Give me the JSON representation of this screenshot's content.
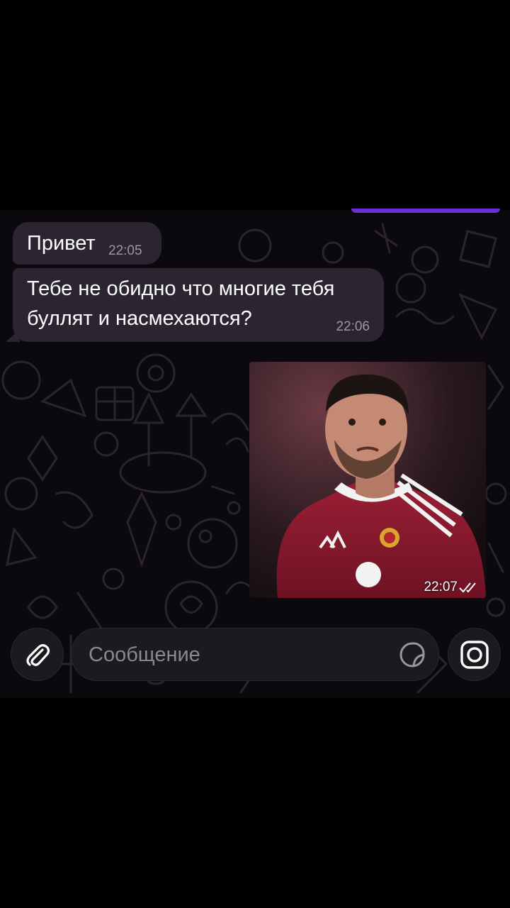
{
  "messages": [
    {
      "text": "Привет",
      "time": "22:05"
    },
    {
      "text": "Тебе не обидно что многие тебя\nбуллят и насмехаются?",
      "time": "22:06"
    }
  ],
  "photo_message": {
    "time": "22:07",
    "status_icon": "double-check-icon"
  },
  "composer": {
    "placeholder": "Сообщение"
  },
  "icons": {
    "attach": "paperclip-icon",
    "sticker": "sticker-icon",
    "camera": "camera-icon"
  },
  "colors": {
    "bubble": "#2b2431",
    "accent": "#6b2fd6",
    "background": "#0b080e",
    "jersey": "#8b1a2e"
  }
}
